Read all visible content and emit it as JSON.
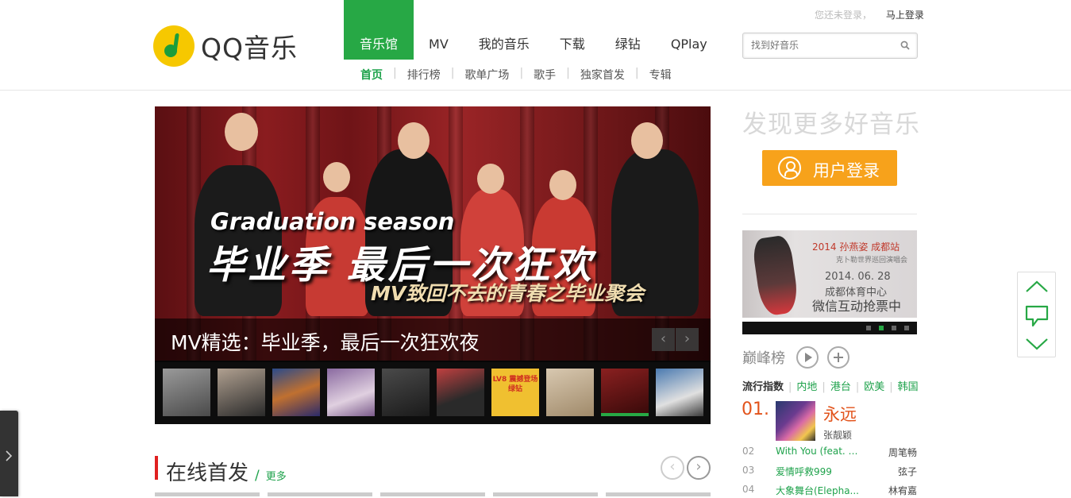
{
  "brand": {
    "logo_text": "QQ音乐"
  },
  "user_bar": {
    "status": "您还未登录，",
    "login_link": "马上登录"
  },
  "search": {
    "placeholder": "找到好音乐"
  },
  "main_nav": [
    {
      "label": "音乐馆",
      "active": true
    },
    {
      "label": "MV"
    },
    {
      "label": "我的音乐"
    },
    {
      "label": "下载"
    },
    {
      "label": "绿钻"
    },
    {
      "label": "QPlay"
    }
  ],
  "sub_nav": [
    {
      "label": "首页",
      "active": true
    },
    {
      "label": "排行榜"
    },
    {
      "label": "歌单广场"
    },
    {
      "label": "歌手"
    },
    {
      "label": "独家首发"
    },
    {
      "label": "专辑"
    }
  ],
  "banner": {
    "headline_en": "Graduation season",
    "headline_cn": "毕业季 最后一次狂欢",
    "subline": "MV致回不去的青春之毕业聚会",
    "caption": "MV精选：毕业季，最后一次狂欢夜",
    "prev_arrow": "‹",
    "next_arrow": "›",
    "thumbnails": [
      {
        "color": "#5a5a5a"
      },
      {
        "color": "#3d3d3d"
      },
      {
        "color": "#6a4a2a"
      },
      {
        "color": "#7a6a80"
      },
      {
        "color": "#2e2e2e"
      },
      {
        "color": "#8a3030"
      },
      {
        "color": "#f0c030",
        "label": "LV8 震撼登场 绿钻"
      },
      {
        "color": "#c8b49a"
      },
      {
        "color": "#6e1a1c",
        "active": true
      },
      {
        "color": "#3a6aa0"
      }
    ]
  },
  "section": {
    "title": "在线首发",
    "slash": "/",
    "more": "更多",
    "prev": "‹",
    "next": "›"
  },
  "sidebar": {
    "promo_title": "发现更多好音乐",
    "login_button": "用户登录",
    "ad": {
      "line1": "2014 孙燕姿 成都站",
      "line2": "克卜勒世界巡回演唱会",
      "line3": "2014. 06. 28",
      "line4": "成都体育中心",
      "line5": "微信互动抢票中",
      "dots": 4,
      "active_dot": 1
    },
    "chart": {
      "title": "巅峰榜",
      "tabs": [
        {
          "label": "流行指数",
          "active": true
        },
        {
          "label": "内地"
        },
        {
          "label": "港台"
        },
        {
          "label": "欧美"
        },
        {
          "label": "韩国"
        }
      ],
      "top": {
        "rank": "01.",
        "title": "永远",
        "artist": "张靓颖"
      },
      "rows": [
        {
          "rank": "02",
          "song": "With You (feat. E...",
          "artist": "周笔畅"
        },
        {
          "rank": "03",
          "song": "爱情呼救999",
          "artist": "弦子"
        },
        {
          "rank": "04",
          "song": "大象舞台(Elepha...",
          "artist": "林宥嘉"
        }
      ]
    }
  },
  "colors": {
    "accent_green": "#27a845",
    "orange": "#f7a21b",
    "rank_red": "#e2531b",
    "section_red": "#e02020"
  }
}
